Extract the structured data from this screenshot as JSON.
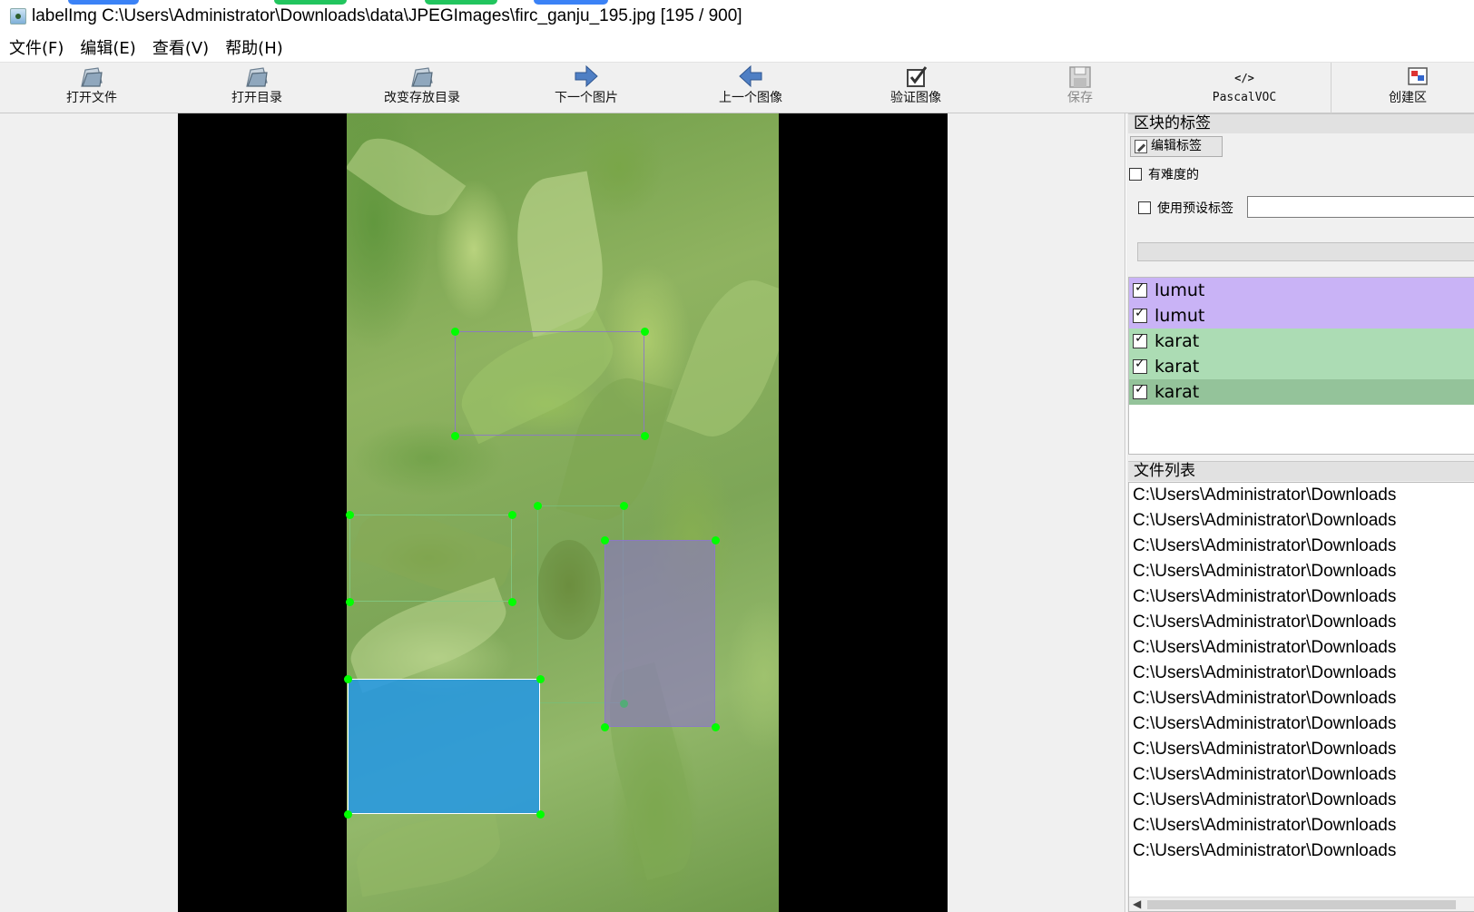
{
  "window": {
    "title": "labelImg C:\\Users\\Administrator\\Downloads\\data\\JPEGImages\\firc_ganju_195.jpg [195 / 900]"
  },
  "menu": {
    "items": [
      {
        "label": "文件(F)"
      },
      {
        "label": "编辑(E)"
      },
      {
        "label": "查看(V)"
      },
      {
        "label": "帮助(H)"
      }
    ]
  },
  "toolbar": {
    "items": [
      {
        "label": "打开文件",
        "icon": "open-folder-icon",
        "enabled": true
      },
      {
        "label": "打开目录",
        "icon": "open-folder-icon",
        "enabled": true
      },
      {
        "label": "改变存放目录",
        "icon": "open-folder-icon",
        "enabled": true
      },
      {
        "label": "下一个图片",
        "icon": "arrow-right-icon",
        "enabled": true
      },
      {
        "label": "上一个图像",
        "icon": "arrow-left-icon",
        "enabled": true
      },
      {
        "label": "验证图像",
        "icon": "checkbox-icon",
        "enabled": true
      },
      {
        "label": "保存",
        "icon": "save-icon",
        "enabled": false
      },
      {
        "label": "PascalVOC",
        "icon": "code-icon",
        "enabled": true
      },
      {
        "label": "创建区",
        "icon": "create-box-icon",
        "enabled": true
      }
    ]
  },
  "annotations": {
    "boxes": [
      {
        "label": "lumut",
        "color": "#9f8fd0",
        "style": "outline"
      },
      {
        "label": "lumut",
        "color": "#8a78c8",
        "style": "filled"
      },
      {
        "label": "karat",
        "color": "#8fc88f",
        "style": "outline"
      },
      {
        "label": "karat",
        "color": "#7fbf7f",
        "style": "outline"
      },
      {
        "label": "karat",
        "color": "#2f9be8",
        "style": "filled-selected"
      }
    ]
  },
  "right_panel": {
    "labels_dock_title": "区块的标签",
    "edit_label_button": "编辑标签",
    "difficult_checkbox": "有难度的",
    "use_default_label_checkbox": "使用预设标签",
    "default_label_value": "",
    "label_list": [
      {
        "label": "lumut",
        "checked": true,
        "bg": "#c9b3f6"
      },
      {
        "label": "lumut",
        "checked": true,
        "bg": "#c9b3f6"
      },
      {
        "label": "karat",
        "checked": true,
        "bg": "#acdcb4"
      },
      {
        "label": "karat",
        "checked": true,
        "bg": "#acdcb4"
      },
      {
        "label": "karat",
        "checked": true,
        "bg": "#94c39a"
      }
    ],
    "file_dock_title": "文件列表",
    "file_list": [
      "C:\\Users\\Administrator\\Downloads",
      "C:\\Users\\Administrator\\Downloads",
      "C:\\Users\\Administrator\\Downloads",
      "C:\\Users\\Administrator\\Downloads",
      "C:\\Users\\Administrator\\Downloads",
      "C:\\Users\\Administrator\\Downloads",
      "C:\\Users\\Administrator\\Downloads",
      "C:\\Users\\Administrator\\Downloads",
      "C:\\Users\\Administrator\\Downloads",
      "C:\\Users\\Administrator\\Downloads",
      "C:\\Users\\Administrator\\Downloads",
      "C:\\Users\\Administrator\\Downloads",
      "C:\\Users\\Administrator\\Downloads",
      "C:\\Users\\Administrator\\Downloads",
      "C:\\Users\\Administrator\\Downloads"
    ]
  }
}
